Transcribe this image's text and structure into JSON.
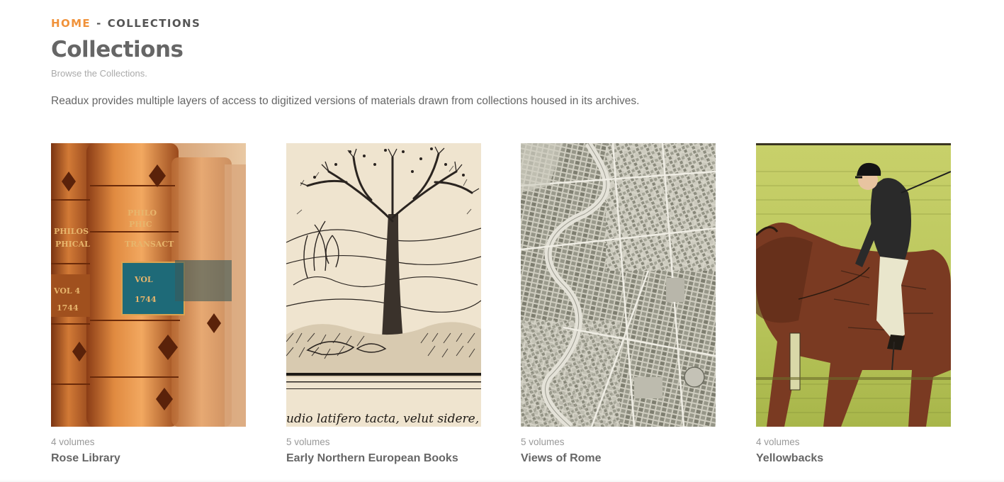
{
  "breadcrumb": {
    "home": "HOME",
    "separator": "-",
    "current": "COLLECTIONS"
  },
  "page": {
    "title": "Collections",
    "subtitle": "Browse the Collections.",
    "intro": "Readux provides multiple layers of access to digitized versions of materials drawn from collections housed in its archives."
  },
  "colors": {
    "accent": "#f0923a",
    "text": "#666666",
    "muted": "#999999"
  },
  "collections": [
    {
      "count": "4 volumes",
      "name": "Rose Library",
      "image": "leather-book-spines-photo"
    },
    {
      "count": "5 volumes",
      "name": "Early Northern European Books",
      "image": "woodcut-tree-engraving",
      "caption": "udio latifero tacta, velut sidere, Past"
    },
    {
      "count": "5 volumes",
      "name": "Views of Rome",
      "image": "historical-map-of-rome"
    },
    {
      "count": "4 volumes",
      "name": "Yellowbacks",
      "image": "jockey-on-horse-illustration"
    }
  ]
}
